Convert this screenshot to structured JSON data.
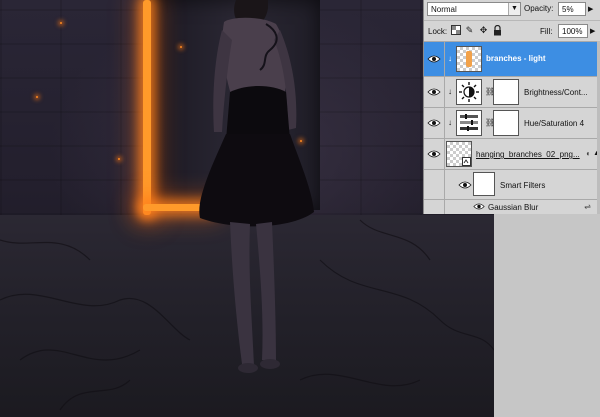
{
  "panel": {
    "blend_mode": "Normal",
    "opacity_label": "Opacity:",
    "opacity_value": "5%",
    "lock_label": "Lock:",
    "fill_label": "Fill:",
    "fill_value": "100%"
  },
  "layers": [
    {
      "name": "branches - light",
      "selected": true,
      "thumb": "checker-orange"
    },
    {
      "name": "Brightness/Cont...",
      "selected": false,
      "thumb": "brightness-icon"
    },
    {
      "name": "Hue/Saturation 4",
      "selected": false,
      "thumb": "hue-icon"
    },
    {
      "name": "hanging_branches_02_png...",
      "selected": false,
      "thumb": "checker"
    },
    {
      "name": "Smart Filters",
      "selected": false
    },
    {
      "name": "Gaussian Blur",
      "selected": false
    }
  ],
  "colors": {
    "selection": "#3d8ee3",
    "panel_bg": "#d5d5d5",
    "door_glow": "#ff9a2a"
  }
}
